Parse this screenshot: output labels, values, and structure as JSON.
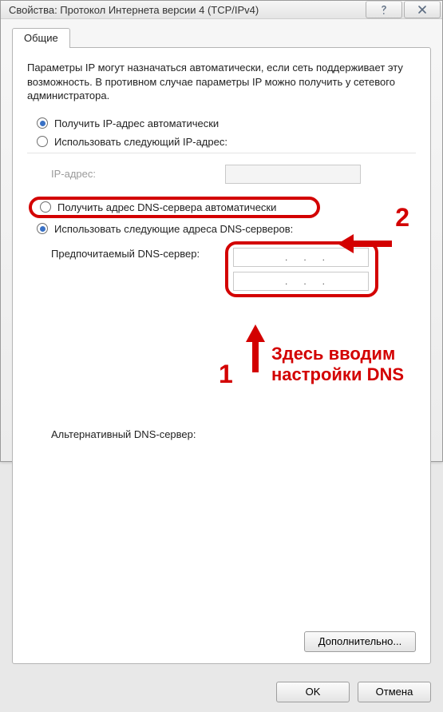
{
  "window": {
    "title": "Свойства: Протокол Интернета версии 4 (TCP/IPv4)"
  },
  "tab": {
    "general": "Общие"
  },
  "intro": "Параметры IP могут назначаться автоматически, если сеть поддерживает эту возможность. В противном случае параметры IP можно получить у сетевого администратора.",
  "ip": {
    "auto_label": "Получить IP-адрес автоматически",
    "manual_label": "Использовать следующий IP-адрес:",
    "ip_address_label": "IP-адрес:",
    "ip_address_value": ""
  },
  "dns": {
    "auto_label": "Получить адрес DNS-сервера автоматически",
    "manual_label": "Использовать следующие адреса DNS-серверов:",
    "preferred_label": "Предпочитаемый DNS-сервер:",
    "alternate_label": "Альтернативный DNS-сервер:",
    "preferred_value": "   .      .      .",
    "alternate_value": "   .      .      ."
  },
  "buttons": {
    "advanced": "Дополнительно...",
    "ok": "OK",
    "cancel": "Отмена"
  },
  "annotations": {
    "num1": "1",
    "num2": "2",
    "text1": "Здесь вводим",
    "text2": "настройки DNS",
    "color": "#d30000"
  }
}
